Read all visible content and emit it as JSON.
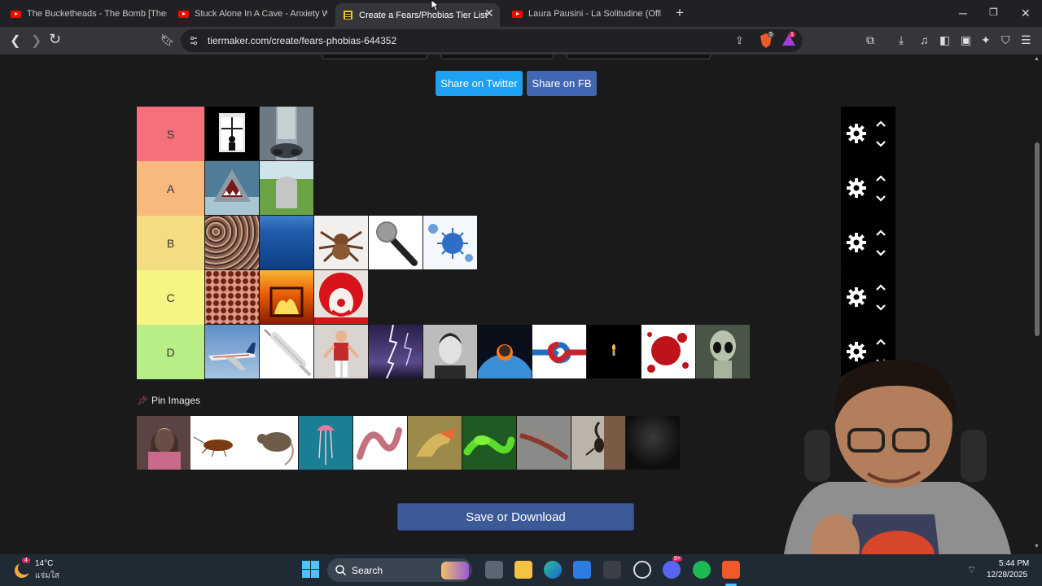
{
  "browser": {
    "tabs": [
      {
        "title": "The Bucketheads - The Bomb [These",
        "icon": "youtube-icon"
      },
      {
        "title": "Stuck Alone In A Cave - Anxiety Warr",
        "icon": "youtube-icon"
      },
      {
        "title": "Create a Fears/Phobias Tier List",
        "icon": "tiermaker-icon",
        "active": true
      },
      {
        "title": "Laura Pausini - La Solitudine (Official",
        "icon": "youtube-icon"
      }
    ],
    "new_tab": "+",
    "url": "tiermaker.com/create/fears-phobias-644352",
    "shields_badge": "5",
    "alert_badge": "1"
  },
  "page": {
    "share_twitter": "Share on Twitter",
    "share_fb": "Share on FB",
    "tiers": [
      {
        "label": "S",
        "color": "#f4717c",
        "items": [
          "window-figure",
          "skyscraper-edge"
        ]
      },
      {
        "label": "A",
        "color": "#f7b97d",
        "items": [
          "shark",
          "gravestone"
        ]
      },
      {
        "label": "B",
        "color": "#f5dc83",
        "items": [
          "crowd",
          "ocean",
          "tarantula",
          "microphone",
          "virus"
        ]
      },
      {
        "label": "C",
        "color": "#f4f583",
        "items": [
          "holes-trypophobia",
          "fire",
          "clown"
        ]
      },
      {
        "label": "D",
        "color": "#b8ee86",
        "items": [
          "airplane",
          "syringe",
          "marionette",
          "lightning",
          "ted-bundy",
          "asteroid-earth",
          "knot",
          "candle-dark",
          "blood",
          "alien"
        ]
      }
    ],
    "pin_images_label": "Pin Images",
    "pin_images": [
      "scared-girl",
      "cockroach",
      "rat",
      "jellyfish",
      "worm",
      "lizard",
      "snake",
      "centipede",
      "scorpion",
      "dark-figure"
    ],
    "save_button": "Save or Download"
  },
  "taskbar": {
    "weather_temp": "14°C",
    "weather_desc": "แจ่มใส",
    "weather_badge": "4",
    "search_text": "Search",
    "discord_badge": "9+",
    "time": "5:44 PM",
    "date": "12/28/2025"
  }
}
